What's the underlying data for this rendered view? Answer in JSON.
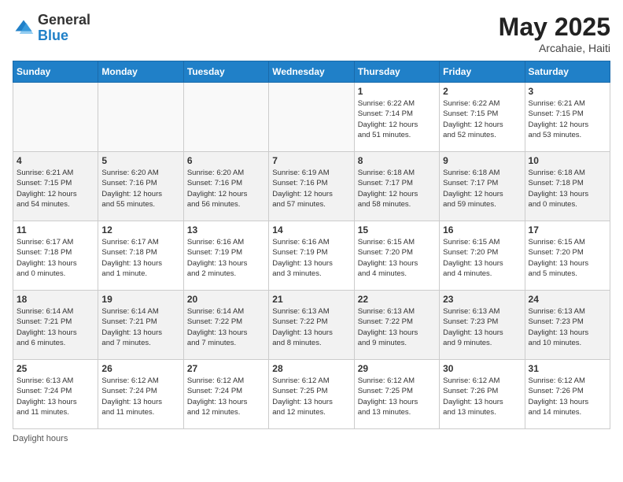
{
  "header": {
    "logo_general": "General",
    "logo_blue": "Blue",
    "month_year": "May 2025",
    "location": "Arcahaie, Haiti"
  },
  "weekdays": [
    "Sunday",
    "Monday",
    "Tuesday",
    "Wednesday",
    "Thursday",
    "Friday",
    "Saturday"
  ],
  "weeks": [
    [
      {
        "day": "",
        "info": ""
      },
      {
        "day": "",
        "info": ""
      },
      {
        "day": "",
        "info": ""
      },
      {
        "day": "",
        "info": ""
      },
      {
        "day": "1",
        "info": "Sunrise: 6:22 AM\nSunset: 7:14 PM\nDaylight: 12 hours\nand 51 minutes."
      },
      {
        "day": "2",
        "info": "Sunrise: 6:22 AM\nSunset: 7:15 PM\nDaylight: 12 hours\nand 52 minutes."
      },
      {
        "day": "3",
        "info": "Sunrise: 6:21 AM\nSunset: 7:15 PM\nDaylight: 12 hours\nand 53 minutes."
      }
    ],
    [
      {
        "day": "4",
        "info": "Sunrise: 6:21 AM\nSunset: 7:15 PM\nDaylight: 12 hours\nand 54 minutes."
      },
      {
        "day": "5",
        "info": "Sunrise: 6:20 AM\nSunset: 7:16 PM\nDaylight: 12 hours\nand 55 minutes."
      },
      {
        "day": "6",
        "info": "Sunrise: 6:20 AM\nSunset: 7:16 PM\nDaylight: 12 hours\nand 56 minutes."
      },
      {
        "day": "7",
        "info": "Sunrise: 6:19 AM\nSunset: 7:16 PM\nDaylight: 12 hours\nand 57 minutes."
      },
      {
        "day": "8",
        "info": "Sunrise: 6:18 AM\nSunset: 7:17 PM\nDaylight: 12 hours\nand 58 minutes."
      },
      {
        "day": "9",
        "info": "Sunrise: 6:18 AM\nSunset: 7:17 PM\nDaylight: 12 hours\nand 59 minutes."
      },
      {
        "day": "10",
        "info": "Sunrise: 6:18 AM\nSunset: 7:18 PM\nDaylight: 13 hours\nand 0 minutes."
      }
    ],
    [
      {
        "day": "11",
        "info": "Sunrise: 6:17 AM\nSunset: 7:18 PM\nDaylight: 13 hours\nand 0 minutes."
      },
      {
        "day": "12",
        "info": "Sunrise: 6:17 AM\nSunset: 7:18 PM\nDaylight: 13 hours\nand 1 minute."
      },
      {
        "day": "13",
        "info": "Sunrise: 6:16 AM\nSunset: 7:19 PM\nDaylight: 13 hours\nand 2 minutes."
      },
      {
        "day": "14",
        "info": "Sunrise: 6:16 AM\nSunset: 7:19 PM\nDaylight: 13 hours\nand 3 minutes."
      },
      {
        "day": "15",
        "info": "Sunrise: 6:15 AM\nSunset: 7:20 PM\nDaylight: 13 hours\nand 4 minutes."
      },
      {
        "day": "16",
        "info": "Sunrise: 6:15 AM\nSunset: 7:20 PM\nDaylight: 13 hours\nand 4 minutes."
      },
      {
        "day": "17",
        "info": "Sunrise: 6:15 AM\nSunset: 7:20 PM\nDaylight: 13 hours\nand 5 minutes."
      }
    ],
    [
      {
        "day": "18",
        "info": "Sunrise: 6:14 AM\nSunset: 7:21 PM\nDaylight: 13 hours\nand 6 minutes."
      },
      {
        "day": "19",
        "info": "Sunrise: 6:14 AM\nSunset: 7:21 PM\nDaylight: 13 hours\nand 7 minutes."
      },
      {
        "day": "20",
        "info": "Sunrise: 6:14 AM\nSunset: 7:22 PM\nDaylight: 13 hours\nand 7 minutes."
      },
      {
        "day": "21",
        "info": "Sunrise: 6:13 AM\nSunset: 7:22 PM\nDaylight: 13 hours\nand 8 minutes."
      },
      {
        "day": "22",
        "info": "Sunrise: 6:13 AM\nSunset: 7:22 PM\nDaylight: 13 hours\nand 9 minutes."
      },
      {
        "day": "23",
        "info": "Sunrise: 6:13 AM\nSunset: 7:23 PM\nDaylight: 13 hours\nand 9 minutes."
      },
      {
        "day": "24",
        "info": "Sunrise: 6:13 AM\nSunset: 7:23 PM\nDaylight: 13 hours\nand 10 minutes."
      }
    ],
    [
      {
        "day": "25",
        "info": "Sunrise: 6:13 AM\nSunset: 7:24 PM\nDaylight: 13 hours\nand 11 minutes."
      },
      {
        "day": "26",
        "info": "Sunrise: 6:12 AM\nSunset: 7:24 PM\nDaylight: 13 hours\nand 11 minutes."
      },
      {
        "day": "27",
        "info": "Sunrise: 6:12 AM\nSunset: 7:24 PM\nDaylight: 13 hours\nand 12 minutes."
      },
      {
        "day": "28",
        "info": "Sunrise: 6:12 AM\nSunset: 7:25 PM\nDaylight: 13 hours\nand 12 minutes."
      },
      {
        "day": "29",
        "info": "Sunrise: 6:12 AM\nSunset: 7:25 PM\nDaylight: 13 hours\nand 13 minutes."
      },
      {
        "day": "30",
        "info": "Sunrise: 6:12 AM\nSunset: 7:26 PM\nDaylight: 13 hours\nand 13 minutes."
      },
      {
        "day": "31",
        "info": "Sunrise: 6:12 AM\nSunset: 7:26 PM\nDaylight: 13 hours\nand 14 minutes."
      }
    ]
  ],
  "footer": {
    "daylight_hours_label": "Daylight hours"
  }
}
